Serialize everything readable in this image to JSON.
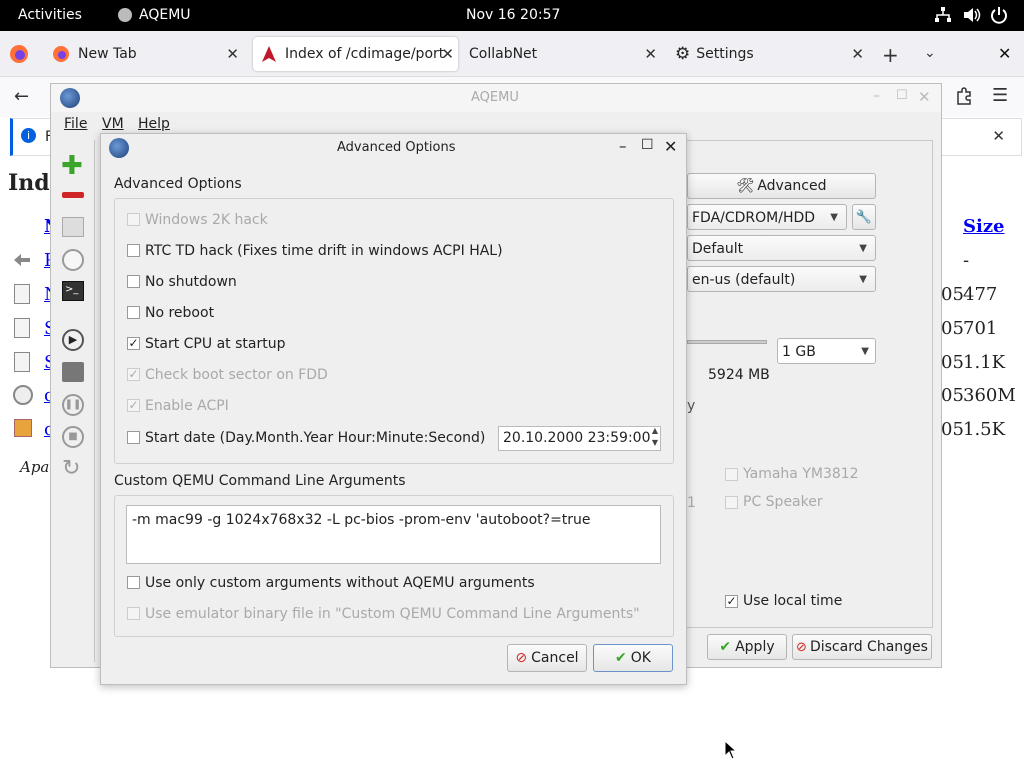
{
  "topbar": {
    "activities": "Activities",
    "app_name": "AQEMU",
    "clock": "Nov 16  20:57"
  },
  "browser": {
    "tabs": [
      {
        "label": "New Tab"
      },
      {
        "label": "Index of /cdimage/port"
      },
      {
        "label": "CollabNet"
      },
      {
        "label": "Settings"
      }
    ],
    "notif_letter": "F",
    "page_title_fragment": "Ind",
    "size_header": "Size",
    "rows": [
      {
        "letter": "P",
        "date": "",
        "size": "-"
      },
      {
        "letter": "N",
        "date": "05",
        "size": "477"
      },
      {
        "letter": "S",
        "date": "05",
        "size": "701"
      },
      {
        "letter": "S",
        "date": "05",
        "size": "1.1K"
      },
      {
        "letter": "c",
        "date": "05",
        "size": "360M"
      },
      {
        "letter": "c",
        "date": "05",
        "size": "1.5K"
      }
    ],
    "footer_fragment": "Apac"
  },
  "aqemu": {
    "title": "AQEMU",
    "menu": [
      "File",
      "VM",
      "Help"
    ],
    "advanced_button": "Advanced",
    "boot_device": "FDA/CDROM/HDD",
    "video_combo": "Default",
    "keyboard_combo": "en-us (default)",
    "memory_value": "1 GB",
    "free_memory": "5924 MB",
    "fragment_y": "y",
    "fragment_1": "1",
    "sound_yamaha": "Yamaha YM3812",
    "sound_speaker": "PC Speaker",
    "use_local_time": "Use local time",
    "apply": "Apply",
    "discard": "Discard Changes"
  },
  "dialog": {
    "title": "Advanced Options",
    "group1_title": "Advanced Options",
    "options": [
      {
        "label": "Windows 2K hack",
        "checked": false,
        "disabled": true
      },
      {
        "label": "RTC TD hack (Fixes time drift in windows ACPI HAL)",
        "checked": false,
        "disabled": false
      },
      {
        "label": "No shutdown",
        "checked": false,
        "disabled": false
      },
      {
        "label": "No reboot",
        "checked": false,
        "disabled": false
      },
      {
        "label": "Start CPU at startup",
        "checked": true,
        "disabled": false
      },
      {
        "label": "Check boot sector on FDD",
        "checked": true,
        "disabled": true
      },
      {
        "label": "Enable ACPI",
        "checked": true,
        "disabled": true
      },
      {
        "label": "Start date (Day.Month.Year Hour:Minute:Second)",
        "checked": false,
        "disabled": false
      }
    ],
    "start_date_value": "20.10.2000 23:59:00",
    "group2_title": "Custom QEMU Command Line Arguments",
    "args_value": "-m mac99 -g 1024x768x32 -L pc-bios -prom-env 'autoboot?=true",
    "only_custom": "Use only custom arguments without AQEMU arguments",
    "use_binary": "Use emulator binary file in \"Custom QEMU Command Line Arguments\"",
    "cancel": "Cancel",
    "ok": "OK"
  },
  "icons": {
    "accent": "#0060df",
    "add": "#3aa52a",
    "remove": "#d02525"
  }
}
